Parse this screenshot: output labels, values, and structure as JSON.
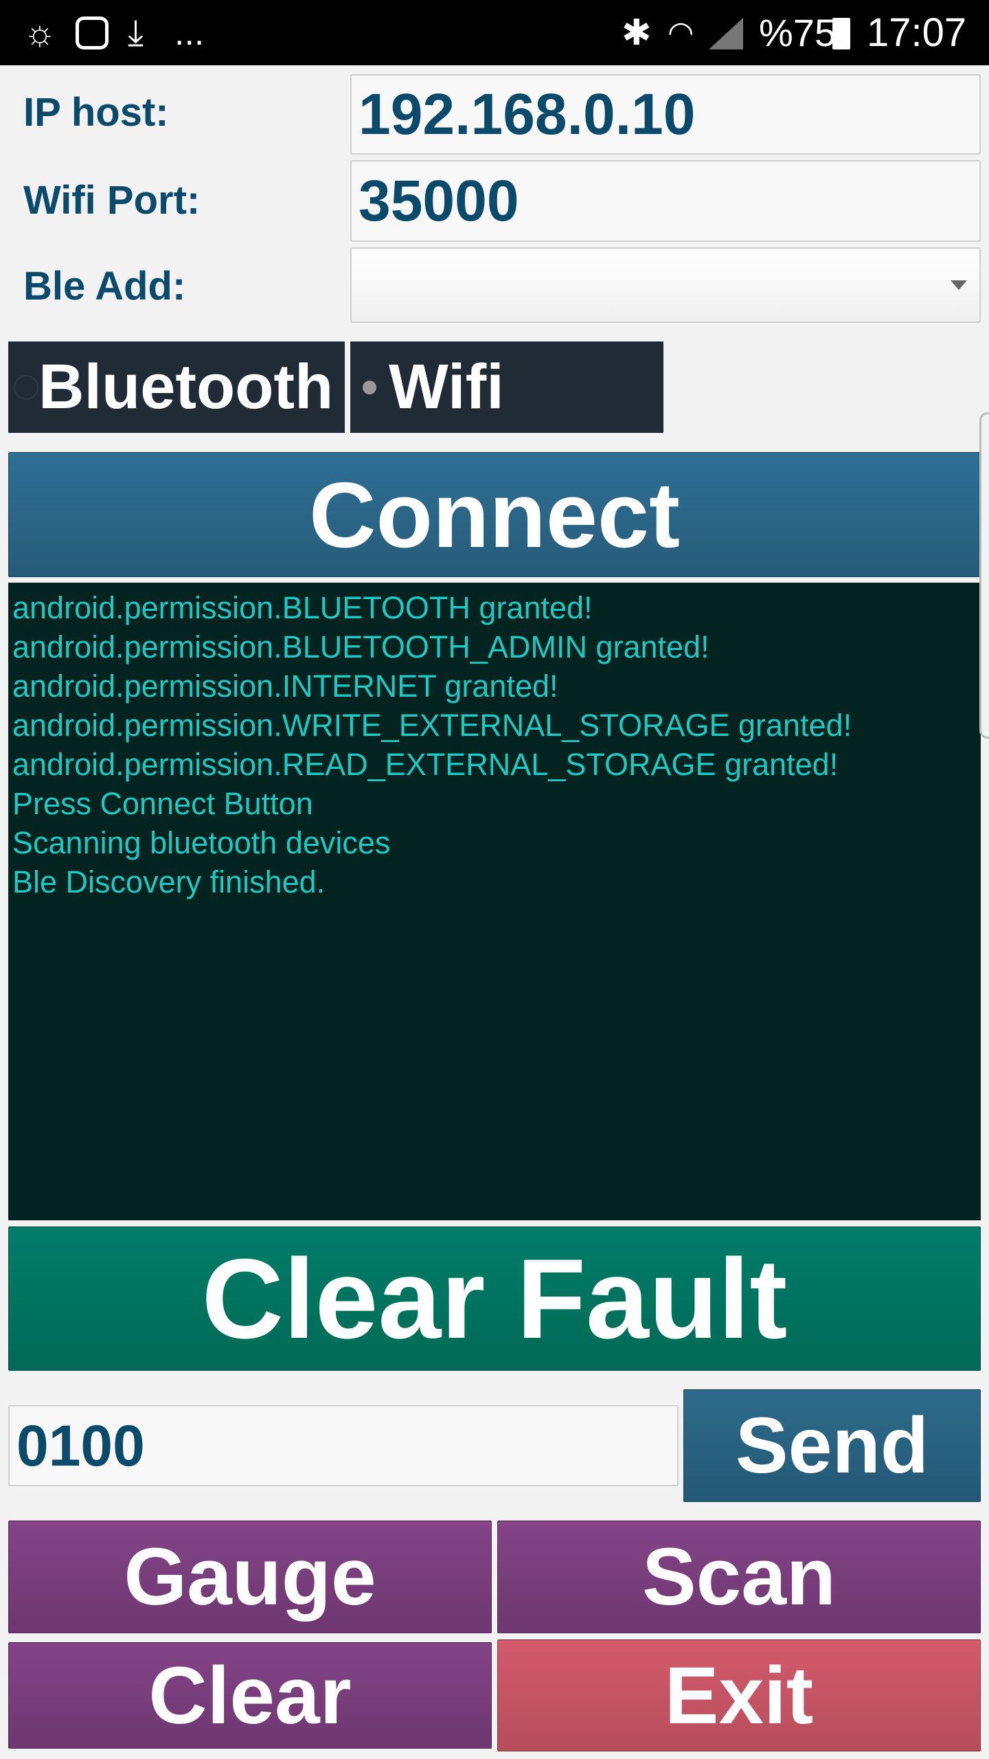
{
  "status_bar": {
    "battery": "%75",
    "time": "17:07",
    "overflow": "..."
  },
  "form": {
    "ip_label": "IP host:",
    "ip_value": "192.168.0.10",
    "port_label": "Wifi Port:",
    "port_value": "35000",
    "ble_label": "Ble Add:",
    "ble_value": ""
  },
  "mode": {
    "bluetooth": "Bluetooth",
    "wifi": "Wifi",
    "selected": "wifi"
  },
  "buttons": {
    "connect": "Connect",
    "clear_fault": "Clear Fault",
    "send": "Send",
    "gauge": "Gauge",
    "scan": "Scan",
    "clear": "Clear",
    "exit": "Exit"
  },
  "command_input": {
    "value": "0100"
  },
  "log": [
    "android.permission.BLUETOOTH granted!",
    "android.permission.BLUETOOTH_ADMIN granted!",
    "android.permission.INTERNET granted!",
    "android.permission.WRITE_EXTERNAL_STORAGE granted!",
    "android.permission.READ_EXTERNAL_STORAGE granted!",
    "Press Connect Button",
    "Scanning bluetooth devices",
    "Ble Discovery finished."
  ],
  "colors": {
    "label": "#0b4a6b",
    "connect": "#2b6788",
    "clear_fault": "#00755f",
    "purple": "#7a3f7d",
    "exit": "#cc5866",
    "log_text": "#1fc8c0",
    "log_bg": "#022320"
  }
}
